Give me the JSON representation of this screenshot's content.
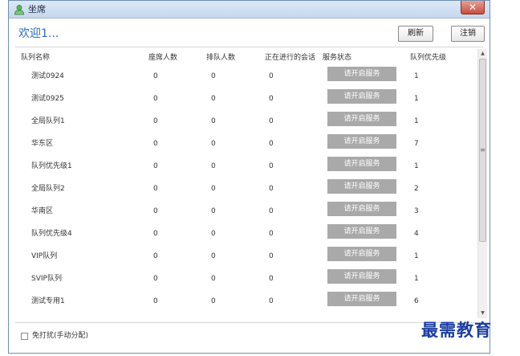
{
  "window": {
    "title": "坐席",
    "title_icon": "user-icon",
    "close_icon": "close-icon",
    "close_glyph": "✕"
  },
  "header": {
    "welcome": "欢迎1...",
    "refresh_label": "刷新",
    "logout_label": "注销"
  },
  "table": {
    "columns": [
      "队列名称",
      "座席人数",
      "排队人数",
      "正在进行的会话",
      "服务状态",
      "队列优先级"
    ],
    "rows": [
      {
        "name": "测试0924",
        "agents": "0",
        "queued": "0",
        "sessions": "0",
        "status": "请开启服务",
        "priority": "1"
      },
      {
        "name": "测试0925",
        "agents": "0",
        "queued": "0",
        "sessions": "0",
        "status": "请开启服务",
        "priority": "1"
      },
      {
        "name": "全局队列1",
        "agents": "0",
        "queued": "0",
        "sessions": "0",
        "status": "请开启服务",
        "priority": "1"
      },
      {
        "name": "华东区",
        "agents": "0",
        "queued": "0",
        "sessions": "0",
        "status": "请开启服务",
        "priority": "7"
      },
      {
        "name": "队列优先级1",
        "agents": "0",
        "queued": "0",
        "sessions": "0",
        "status": "请开启服务",
        "priority": "1"
      },
      {
        "name": "全局队列2",
        "agents": "0",
        "queued": "0",
        "sessions": "0",
        "status": "请开启服务",
        "priority": "2"
      },
      {
        "name": "华南区",
        "agents": "0",
        "queued": "0",
        "sessions": "0",
        "status": "请开启服务",
        "priority": "3"
      },
      {
        "name": "队列优先级4",
        "agents": "0",
        "queued": "0",
        "sessions": "0",
        "status": "请开启服务",
        "priority": "4"
      },
      {
        "name": "VIP队列",
        "agents": "0",
        "queued": "0",
        "sessions": "0",
        "status": "请开启服务",
        "priority": "1"
      },
      {
        "name": "SVIP队列",
        "agents": "0",
        "queued": "0",
        "sessions": "0",
        "status": "请开启服务",
        "priority": "1"
      },
      {
        "name": "测试专用1",
        "agents": "0",
        "queued": "0",
        "sessions": "0",
        "status": "请开启服务",
        "priority": "6"
      }
    ]
  },
  "scrollbar": {
    "up_glyph": "▲",
    "down_glyph": "▼",
    "grip_glyph": "≡"
  },
  "footer": {
    "dnd_label": "免打扰(手动分配)",
    "dnd_checked": false
  },
  "watermark": "最需教育",
  "colors": {
    "accent": "#2c6fc1",
    "status_button": "#a9a9a9",
    "watermark": "#1a3da3"
  }
}
